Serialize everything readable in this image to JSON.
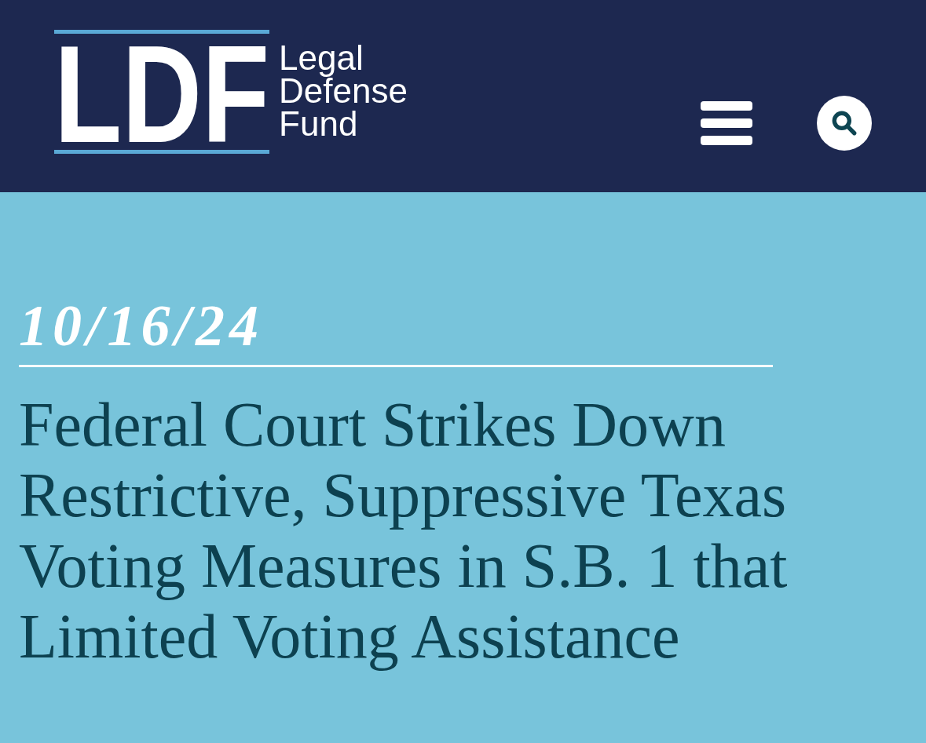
{
  "header": {
    "logo": {
      "mark": "LDF",
      "name_lines": [
        "Legal",
        "Defense",
        "Fund"
      ]
    }
  },
  "article": {
    "date": "10/16/24",
    "title": "Federal Court Strikes Down Restrictive, Suppressive Texas Voting Measures in S.B. 1 that Limited Voting Assistance"
  }
}
